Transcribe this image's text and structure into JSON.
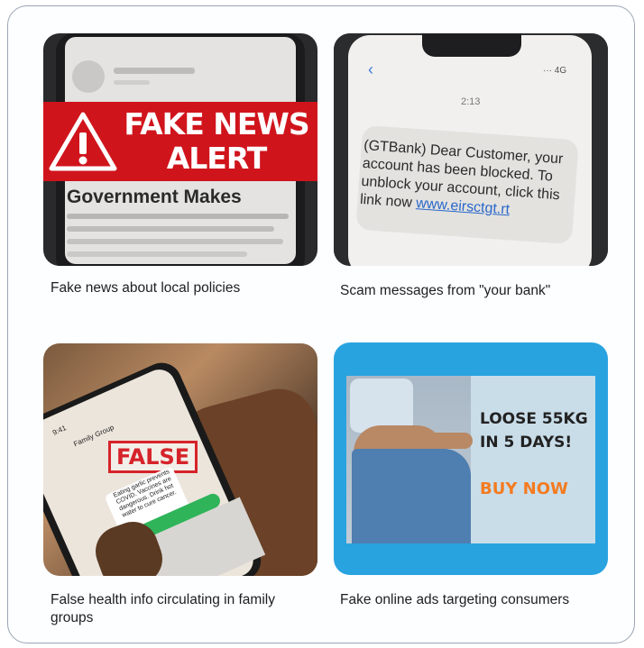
{
  "items": [
    {
      "caption": "Fake news about local policies",
      "image": {
        "banner_line1": "FAKE NEWS",
        "banner_line2": "ALERT",
        "headline": "Government Makes",
        "icon": "warning-triangle-icon"
      }
    },
    {
      "caption": "Scam messages from \"your bank\"",
      "image": {
        "time": "2:13",
        "message": "(GTBank) Dear Customer, your account has been blocked. To unblock your account, click this link now",
        "link": "www.eirsctgt.rt",
        "status": "··· 4G"
      }
    },
    {
      "caption": "False health info circulating in family groups",
      "image": {
        "stamp": "FALSE",
        "chat_message": "Eating garlic prevents COVID. Vaccines are dangerous. Drink hot water to cure cancer.",
        "time": "9:41",
        "group": "Family Group"
      }
    },
    {
      "caption": "Fake online ads targeting consumers",
      "image": {
        "ad_line1": "LOOSE 55KG",
        "ad_line2": "IN 5 DAYS!",
        "cta": "BUY NOW"
      }
    }
  ],
  "colors": {
    "alert_red": "#d0141c",
    "ad_orange": "#f47b20",
    "ad_frame_blue": "#29a3e0",
    "link_blue": "#2a67c9"
  }
}
